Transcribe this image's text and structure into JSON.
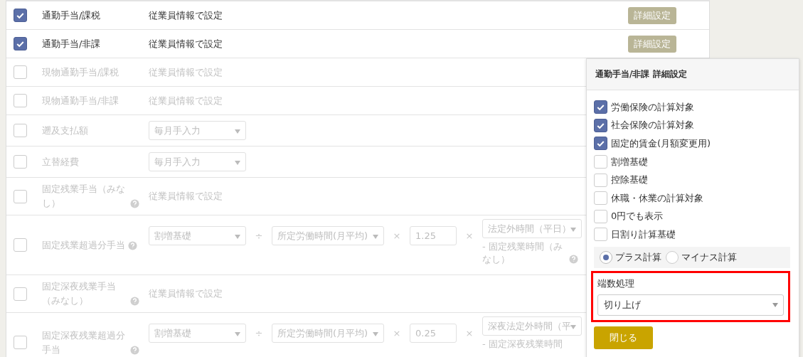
{
  "rows": [
    {
      "label": "通勤手当/課税",
      "checked": true,
      "kind": "text",
      "value": "従業員情報で設定",
      "help": false,
      "detail_button": "詳細設定"
    },
    {
      "label": "通勤手当/非課",
      "checked": true,
      "kind": "text",
      "value": "従業員情報で設定",
      "help": false,
      "detail_button": "詳細設定"
    },
    {
      "label": "現物通勤手当/課税",
      "checked": false,
      "kind": "text",
      "value": "従業員情報で設定",
      "help": false
    },
    {
      "label": "現物通勤手当/非課",
      "checked": false,
      "kind": "text",
      "value": "従業員情報で設定",
      "help": false
    },
    {
      "label": "遡及支払額",
      "checked": false,
      "kind": "select",
      "value": "毎月手入力",
      "help": false
    },
    {
      "label": "立替経費",
      "checked": false,
      "kind": "select",
      "value": "毎月手入力",
      "help": false
    },
    {
      "label": "固定残業手当（みなし）",
      "checked": false,
      "kind": "text",
      "value": "従業員情報で設定",
      "help": true
    },
    {
      "label": "固定残業超過分手当",
      "checked": false,
      "kind": "formula",
      "help": true,
      "formula": {
        "base": "割増基礎",
        "divide": "÷",
        "hours": "所定労働時間(月平均)",
        "times1": "×",
        "rate": "1.25",
        "times2": "×",
        "overtime": "法定外時間（平日）",
        "note": "- 固定残業時間（みなし）",
        "note_help": true
      }
    },
    {
      "label": "固定深夜残業手当（みなし）",
      "checked": false,
      "kind": "text",
      "value": "従業員情報で設定",
      "help": true
    },
    {
      "label": "固定深夜残業超過分手当",
      "checked": false,
      "kind": "formula",
      "help": true,
      "formula": {
        "base": "割増基礎",
        "divide": "÷",
        "hours": "所定労働時間(月平均)",
        "times1": "×",
        "rate": "0.25",
        "times2": "×",
        "overtime": "深夜法定外時間（平",
        "note": "- 固定深夜残業時間",
        "note_help": false
      }
    }
  ],
  "popup": {
    "title": "通勤手当/非課 詳細設定",
    "options": [
      {
        "label": "労働保険の計算対象",
        "checked": true
      },
      {
        "label": "社会保険の計算対象",
        "checked": true
      },
      {
        "label": "固定的賃金(月額変更用)",
        "checked": true
      },
      {
        "label": "割増基礎",
        "checked": false
      },
      {
        "label": "控除基礎",
        "checked": false
      },
      {
        "label": "休職・休業の計算対象",
        "checked": false
      },
      {
        "label": "0円でも表示",
        "checked": false
      },
      {
        "label": "日割り計算基礎",
        "checked": false
      }
    ],
    "calc": [
      {
        "label": "プラス計算",
        "selected": true
      },
      {
        "label": "マイナス計算",
        "selected": false
      }
    ],
    "rounding": {
      "label": "端数処理",
      "value": "切り上げ",
      "highlighted": true
    },
    "close_button": "閉じる"
  }
}
